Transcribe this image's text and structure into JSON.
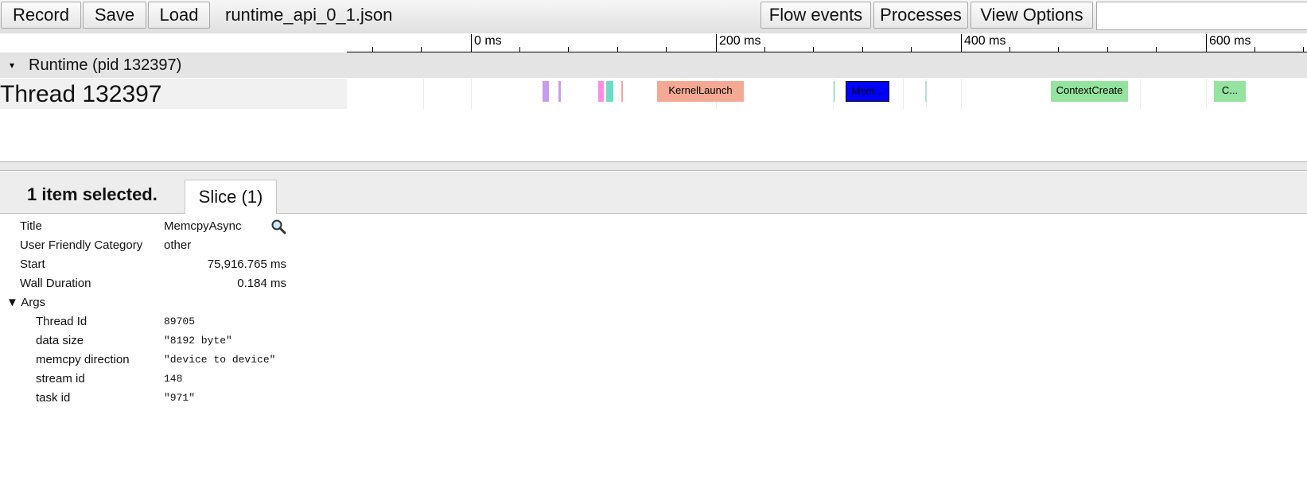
{
  "toolbar": {
    "record_label": "Record",
    "save_label": "Save",
    "load_label": "Load",
    "filename": "runtime_api_0_1.json",
    "flow_events_label": "Flow events",
    "processes_label": "Processes",
    "view_options_label": "View Options",
    "search_value": ""
  },
  "ruler": {
    "labels": [
      "0 ms",
      "200 ms",
      "400 ms",
      "600 ms"
    ]
  },
  "process": {
    "expander": "▾",
    "title": "Runtime (pid 132397)"
  },
  "thread": {
    "label": "Thread 132397",
    "slices": [
      {
        "title": "KernelLaunch",
        "color": "#f5a893"
      },
      {
        "title": "Mem...",
        "color": "#0000ff"
      },
      {
        "title": "ContextCreate",
        "color": "#94e39e"
      },
      {
        "title": "C...",
        "color": "#94e39e"
      }
    ]
  },
  "analysis": {
    "selection_label": "1 item selected.",
    "tab_label": "Slice (1)",
    "fields": {
      "title_key": "Title",
      "title_value": "MemcpyAsync",
      "category_key": "User Friendly Category",
      "category_value": "other",
      "start_key": "Start",
      "start_value": "75,916.765 ms",
      "duration_key": "Wall Duration",
      "duration_value": "0.184 ms",
      "args_toggle": "▼",
      "args_label": "Args"
    },
    "args": [
      {
        "key": "Thread Id",
        "value": "89705"
      },
      {
        "key": "data size",
        "value": "\"8192 byte\""
      },
      {
        "key": "memcpy direction",
        "value": "\"device to device\""
      },
      {
        "key": "stream id",
        "value": "148"
      },
      {
        "key": "task id",
        "value": "\"971\""
      }
    ]
  }
}
